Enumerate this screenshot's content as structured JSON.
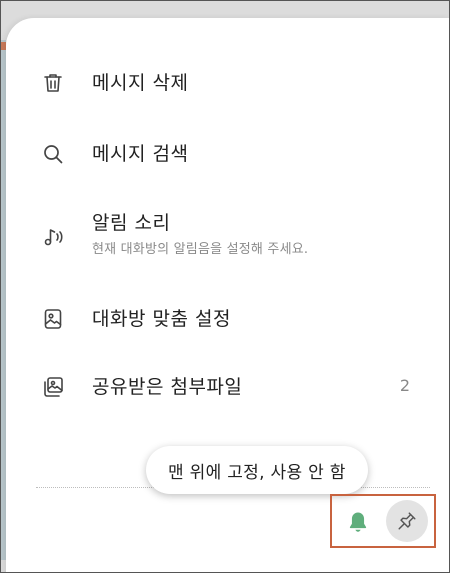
{
  "menu": {
    "items": [
      {
        "icon": "trash-icon",
        "label": "메시지 삭제"
      },
      {
        "icon": "search-icon",
        "label": "메시지 검색"
      },
      {
        "icon": "music-note-icon",
        "label": "알림 소리",
        "sub": "현재 대화방의 알림음을 설정해 주세요."
      },
      {
        "icon": "image-frame-icon",
        "label": "대화방 맞춤 설정"
      },
      {
        "icon": "gallery-icon",
        "label": "공유받은 첨부파일",
        "count": "2"
      }
    ]
  },
  "tooltip": {
    "text": "맨 위에 고정, 사용 안 함"
  },
  "actions": {
    "bell_icon": "bell-icon",
    "pin_icon": "pin-icon",
    "bell_color": "#5fae7c",
    "highlight_color": "#c8633f"
  }
}
